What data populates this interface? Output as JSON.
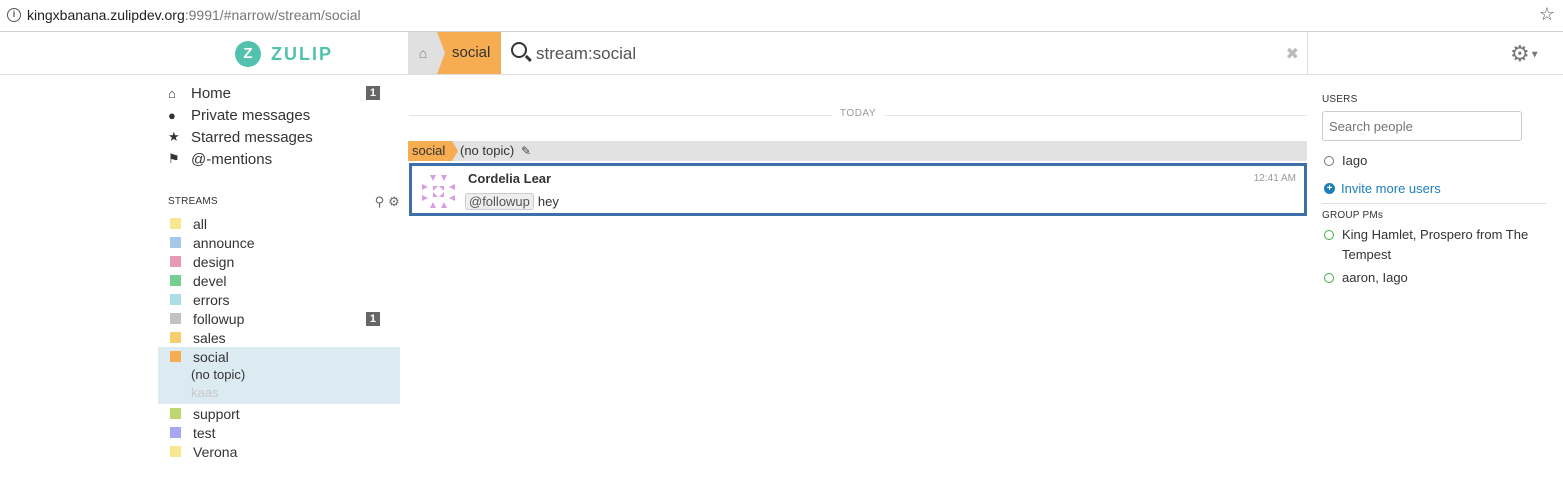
{
  "browser": {
    "url_host": "kingxbanana.zulipdev.org",
    "url_rest": ":9991/#narrow/stream/social",
    "info_icon": "info-icon",
    "star_icon": "star-icon"
  },
  "header": {
    "logo_letter": "Z",
    "logo_text": "ZULIP",
    "home_icon": "home-icon",
    "stream_tab": "social",
    "search_query": "stream:social",
    "clear_icon": "close-icon",
    "settings_icon": "gear-icon"
  },
  "left_sidebar": {
    "nav": [
      {
        "icon": "home-icon",
        "label": "Home",
        "count": "1"
      },
      {
        "icon": "user-icon",
        "label": "Private messages",
        "count": ""
      },
      {
        "icon": "star-icon",
        "label": "Starred messages",
        "count": ""
      },
      {
        "icon": "tag-icon",
        "label": "@-mentions",
        "count": ""
      }
    ],
    "streams_header": "STREAMS",
    "streams": [
      {
        "name": "all",
        "color": "#f9e690",
        "count": ""
      },
      {
        "name": "announce",
        "color": "#a6c7e5",
        "count": ""
      },
      {
        "name": "design",
        "color": "#e79ab5",
        "count": ""
      },
      {
        "name": "devel",
        "color": "#76ce90",
        "count": ""
      },
      {
        "name": "errors",
        "color": "#addde6",
        "count": ""
      },
      {
        "name": "followup",
        "color": "#c2c2c2",
        "count": "1"
      },
      {
        "name": "sales",
        "color": "#f5ce6e",
        "count": ""
      },
      {
        "name": "social",
        "color": "#f6ad52",
        "count": ""
      },
      {
        "name": "support",
        "color": "#bfd56f",
        "count": ""
      },
      {
        "name": "test",
        "color": "#a6a6f2",
        "count": ""
      },
      {
        "name": "Verona",
        "color": "#f9e690",
        "count": ""
      }
    ],
    "active_topics": [
      "(no topic)",
      "kaas"
    ]
  },
  "main": {
    "date_divider": "TODAY",
    "recipient_stream": "social",
    "recipient_topic": "(no topic)",
    "edit_icon": "pencil-icon",
    "message": {
      "sender": "Cordelia Lear",
      "time": "12:41 AM",
      "mention": "@followup",
      "text": "hey"
    }
  },
  "right_sidebar": {
    "users_header": "USERS",
    "search_placeholder": "Search people",
    "users": [
      "Iago"
    ],
    "invite_label": "Invite more users",
    "group_pms_header": "GROUP PMs",
    "group_pms": [
      "King Hamlet, Prospero from The Tempest",
      "aaron, Iago"
    ]
  }
}
